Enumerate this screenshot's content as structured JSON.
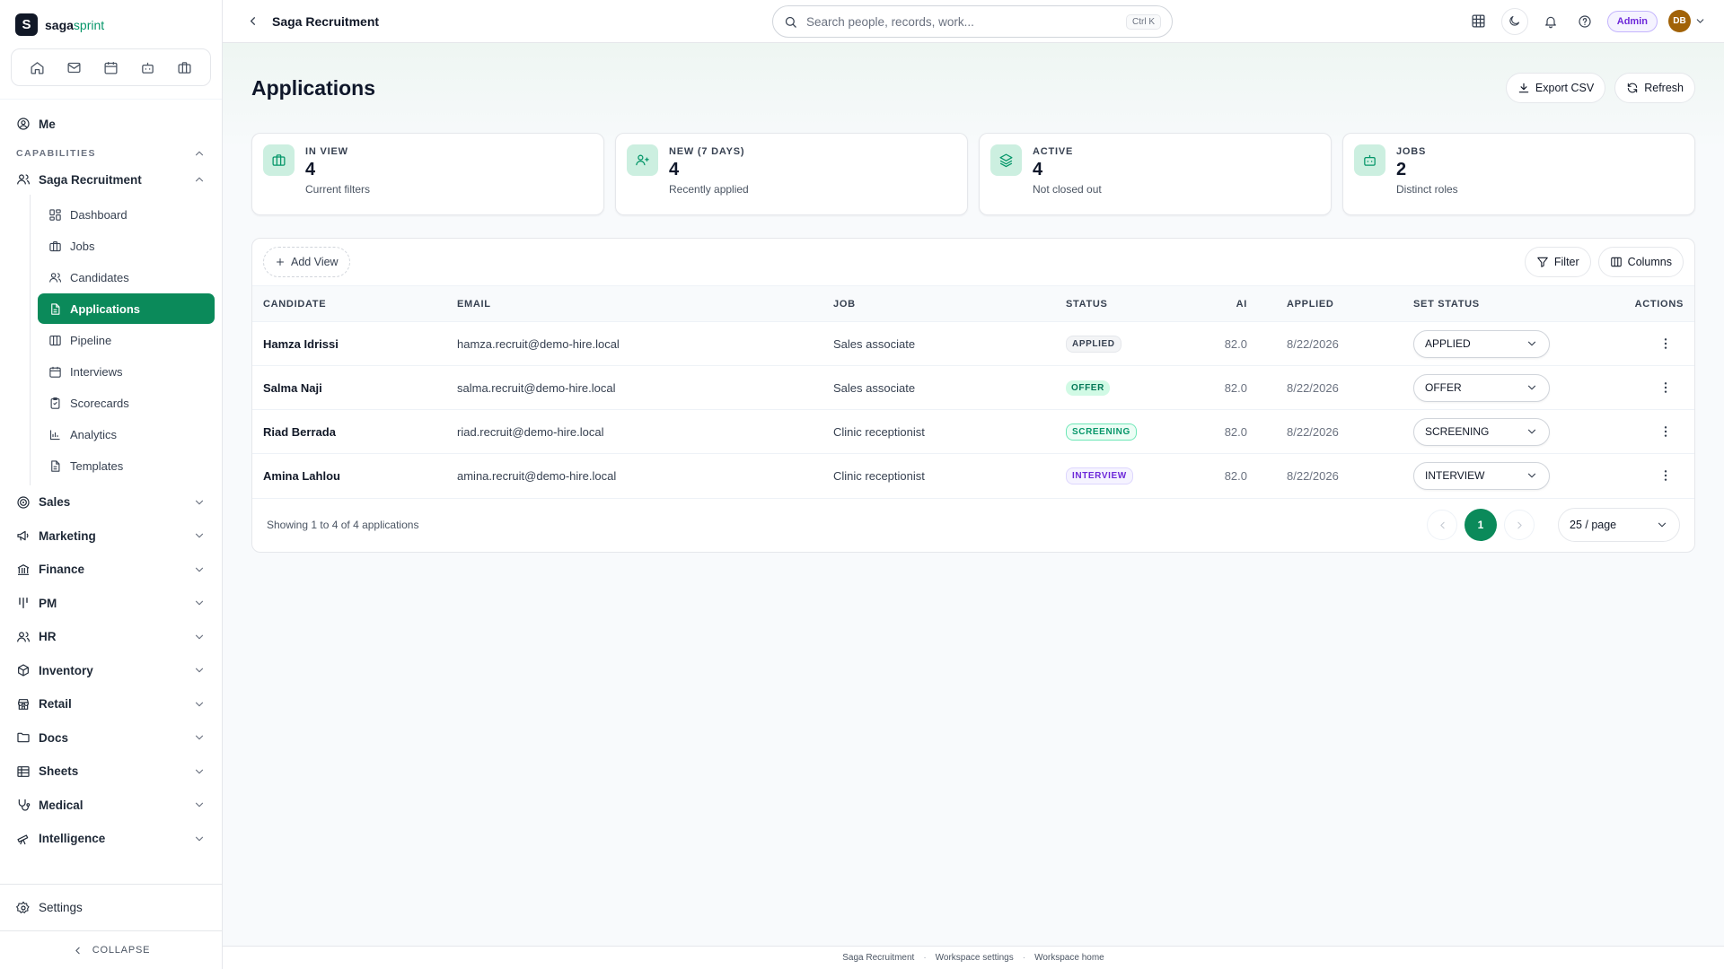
{
  "brand": {
    "logo_letter": "S",
    "name_main": "saga",
    "name_accent": "sprint",
    "accent_color": "#059669"
  },
  "quick_bar": [
    "home-icon",
    "mail-icon",
    "calendar-icon",
    "bot-icon",
    "briefcase-icon"
  ],
  "sidebar": {
    "me": "Me",
    "section_label": "CAPABILITIES",
    "recruitment": {
      "label": "Saga Recruitment",
      "items": [
        {
          "label": "Dashboard",
          "icon": "grid-icon"
        },
        {
          "label": "Jobs",
          "icon": "briefcase-icon"
        },
        {
          "label": "Candidates",
          "icon": "users-icon"
        },
        {
          "label": "Applications",
          "icon": "file-icon",
          "active": true
        },
        {
          "label": "Pipeline",
          "icon": "columns-icon"
        },
        {
          "label": "Interviews",
          "icon": "calendar-icon"
        },
        {
          "label": "Scorecards",
          "icon": "clipboard-icon"
        },
        {
          "label": "Analytics",
          "icon": "chart-icon"
        },
        {
          "label": "Templates",
          "icon": "document-icon"
        }
      ]
    },
    "groups": [
      {
        "label": "Sales",
        "icon": "target-icon"
      },
      {
        "label": "Marketing",
        "icon": "megaphone-icon"
      },
      {
        "label": "Finance",
        "icon": "bank-icon"
      },
      {
        "label": "PM",
        "icon": "kanban-icon"
      },
      {
        "label": "HR",
        "icon": "users-icon"
      },
      {
        "label": "Inventory",
        "icon": "box-icon"
      },
      {
        "label": "Retail",
        "icon": "store-icon"
      },
      {
        "label": "Docs",
        "icon": "folder-icon"
      },
      {
        "label": "Sheets",
        "icon": "table-icon"
      },
      {
        "label": "Medical",
        "icon": "stethoscope-icon"
      },
      {
        "label": "Intelligence",
        "icon": "telescope-icon"
      }
    ],
    "settings": "Settings",
    "collapse": "COLLAPSE"
  },
  "topbar": {
    "breadcrumb": "Saga Recruitment",
    "search_placeholder": "Search people, records, work...",
    "search_shortcut": "Ctrl K",
    "admin_label": "Admin",
    "avatar_initials": "DB"
  },
  "page": {
    "title": "Applications",
    "export_label": "Export CSV",
    "refresh_label": "Refresh"
  },
  "stats": [
    {
      "label": "IN VIEW",
      "value": "4",
      "sub": "Current filters",
      "icon": "briefcase-icon"
    },
    {
      "label": "NEW (7 DAYS)",
      "value": "4",
      "sub": "Recently applied",
      "icon": "user-plus-icon"
    },
    {
      "label": "ACTIVE",
      "value": "4",
      "sub": "Not closed out",
      "icon": "layers-icon"
    },
    {
      "label": "JOBS",
      "value": "2",
      "sub": "Distinct roles",
      "icon": "bot-icon"
    }
  ],
  "table": {
    "add_view": "Add View",
    "filter": "Filter",
    "columns_btn": "Columns",
    "headers": [
      "CANDIDATE",
      "EMAIL",
      "JOB",
      "STATUS",
      "AI",
      "APPLIED",
      "SET STATUS",
      "ACTIONS"
    ],
    "rows": [
      {
        "candidate": "Hamza Idrissi",
        "email": "hamza.recruit@demo-hire.local",
        "job": "Sales associate",
        "status": "APPLIED",
        "ai": "82.0",
        "applied": "8/22/2026",
        "set_status": "APPLIED"
      },
      {
        "candidate": "Salma Naji",
        "email": "salma.recruit@demo-hire.local",
        "job": "Sales associate",
        "status": "OFFER",
        "ai": "82.0",
        "applied": "8/22/2026",
        "set_status": "OFFER"
      },
      {
        "candidate": "Riad Berrada",
        "email": "riad.recruit@demo-hire.local",
        "job": "Clinic receptionist",
        "status": "SCREENING",
        "ai": "82.0",
        "applied": "8/22/2026",
        "set_status": "SCREENING"
      },
      {
        "candidate": "Amina Lahlou",
        "email": "amina.recruit@demo-hire.local",
        "job": "Clinic receptionist",
        "status": "INTERVIEW",
        "ai": "82.0",
        "applied": "8/22/2026",
        "set_status": "INTERVIEW"
      }
    ],
    "showing": "Showing 1 to 4 of 4 applications",
    "current_page": "1",
    "per_page": "25 / page"
  },
  "footer": {
    "links": [
      "Saga Recruitment",
      "Workspace settings",
      "Workspace home"
    ]
  }
}
